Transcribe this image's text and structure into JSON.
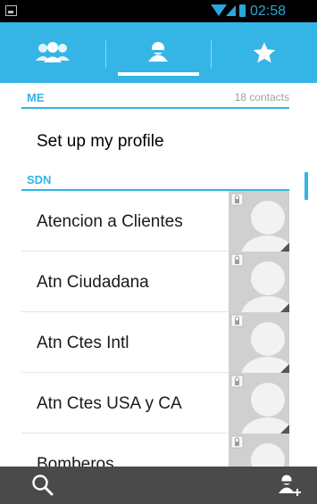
{
  "status_bar": {
    "time": "02:58"
  },
  "tabs": [
    {
      "icon": "groups-icon",
      "selected": false
    },
    {
      "icon": "person-icon",
      "selected": true
    },
    {
      "icon": "star-icon",
      "selected": false
    }
  ],
  "me_section": {
    "title": "ME",
    "count": "18 contacts"
  },
  "profile": {
    "label": "Set up my profile"
  },
  "sdn_section": {
    "title": "SDN"
  },
  "contacts": [
    {
      "name": "Atencion a Clientes"
    },
    {
      "name": "Atn Ciudadana"
    },
    {
      "name": "Atn Ctes Intl"
    },
    {
      "name": "Atn Ctes USA y CA"
    },
    {
      "name": "Bomberos"
    }
  ],
  "bottom_bar": {
    "left_icon": "search-icon",
    "right_icon": "add-contact-icon"
  },
  "colors": {
    "accent": "#33b5e5",
    "tab_bar": "#35b5e5",
    "bottom_bar": "#4a4a4a",
    "photo_bg": "#d0d0d0"
  }
}
